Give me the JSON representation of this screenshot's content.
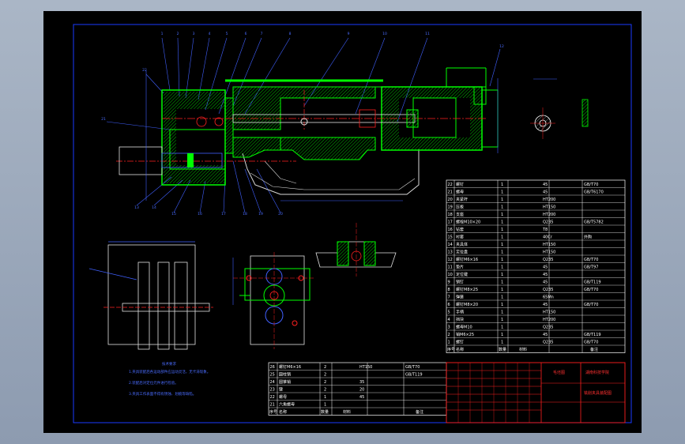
{
  "colors": {
    "background": "#000000",
    "frame": "#1a3aff",
    "part_outline": "#00ff00",
    "section_hatch": "#00c000",
    "center_line": "#ff2020",
    "dimension": "#4060ff",
    "table_line": "#ffffff",
    "title_block": "#ff2020",
    "viewport_bg": "#9aa8bb"
  },
  "title_block": {
    "company": "湖南科技学院",
    "drawing_name": "铣削夹具装配图",
    "material_cell": "毛坯图"
  },
  "notes": {
    "heading": "技术要求",
    "lines": [
      "1.夹具装配后各运动部件应运动灵活，无卡滞现象。",
      "2.装配后对定位元件进行检验。",
      "3.夹具工作表面不得有锈蚀、划痕等缺陷。"
    ]
  },
  "parts_table": {
    "rows": [
      {
        "no": "22",
        "name": "螺钉",
        "qty": "1",
        "material": "45",
        "note": "GB/T70"
      },
      {
        "no": "21",
        "name": "螺母",
        "qty": "1",
        "material": "45",
        "note": "GB/T6170"
      },
      {
        "no": "20",
        "name": "夹紧杆",
        "qty": "1",
        "material": "HT200",
        "note": ""
      },
      {
        "no": "19",
        "name": "压板",
        "qty": "1",
        "material": "HT150",
        "note": ""
      },
      {
        "no": "18",
        "name": "支座",
        "qty": "1",
        "material": "HT200",
        "note": ""
      },
      {
        "no": "17",
        "name": "螺栓M10×20",
        "qty": "1",
        "material": "Q235",
        "note": "GB/T5782"
      },
      {
        "no": "16",
        "name": "钻套",
        "qty": "1",
        "material": "T8",
        "note": ""
      },
      {
        "no": "15",
        "name": "衬套",
        "qty": "1",
        "material": "40Cr",
        "note": "外购"
      },
      {
        "no": "14",
        "name": "夹具体",
        "qty": "1",
        "material": "HT150",
        "note": ""
      },
      {
        "no": "13",
        "name": "定位盘",
        "qty": "1",
        "material": "HT150",
        "note": ""
      },
      {
        "no": "12",
        "name": "螺钉M6×16",
        "qty": "1",
        "material": "Q235",
        "note": "GB/T70"
      },
      {
        "no": "11",
        "name": "垫片",
        "qty": "1",
        "material": "45",
        "note": "GB/T97"
      },
      {
        "no": "10",
        "name": "定位键",
        "qty": "1",
        "material": "45",
        "note": ""
      },
      {
        "no": "9",
        "name": "销钉",
        "qty": "1",
        "material": "45",
        "note": "GB/T119"
      },
      {
        "no": "8",
        "name": "螺钉M8×25",
        "qty": "1",
        "material": "Q235",
        "note": "GB/T70"
      },
      {
        "no": "7",
        "name": "弹簧",
        "qty": "1",
        "material": "65Mn",
        "note": ""
      },
      {
        "no": "6",
        "name": "螺钉M8×20",
        "qty": "1",
        "material": "45",
        "note": "GB/T70"
      },
      {
        "no": "5",
        "name": "手柄",
        "qty": "1",
        "material": "HT150",
        "note": ""
      },
      {
        "no": "4",
        "name": "挡块",
        "qty": "1",
        "material": "HT200",
        "note": ""
      },
      {
        "no": "3",
        "name": "螺母M10",
        "qty": "1",
        "material": "Q235",
        "note": ""
      },
      {
        "no": "2",
        "name": "销M6×25",
        "qty": "1",
        "material": "45",
        "note": "GB/T119"
      },
      {
        "no": "1",
        "name": "螺钉",
        "qty": "1",
        "material": "Q235",
        "note": "GB/T70"
      }
    ],
    "header": {
      "no": "序号",
      "name": "名称",
      "qty": "数量",
      "material": "材料",
      "note": "备注"
    }
  },
  "parts_table_lower": {
    "rows": [
      {
        "no": "26",
        "name": "螺钉M6×16",
        "qty": "2",
        "material": "HT150",
        "note": "GB/T70"
      },
      {
        "no": "25",
        "name": "圆柱销",
        "qty": "2",
        "material": "",
        "note": "GB/T119"
      },
      {
        "no": "24",
        "name": "圆锥销",
        "qty": "2",
        "material": "35",
        "note": ""
      },
      {
        "no": "23",
        "name": "键",
        "qty": "2",
        "material": "20",
        "note": ""
      },
      {
        "no": "22",
        "name": "螺母",
        "qty": "1",
        "material": "45",
        "note": ""
      },
      {
        "no": "21",
        "name": "六角螺母",
        "qty": "1",
        "material": "",
        "note": ""
      }
    ]
  },
  "balloons": [
    "1",
    "2",
    "3",
    "4",
    "5",
    "6",
    "7",
    "8",
    "9",
    "10",
    "11",
    "12",
    "13",
    "14",
    "15",
    "16",
    "17",
    "18",
    "19",
    "20",
    "21",
    "22"
  ]
}
